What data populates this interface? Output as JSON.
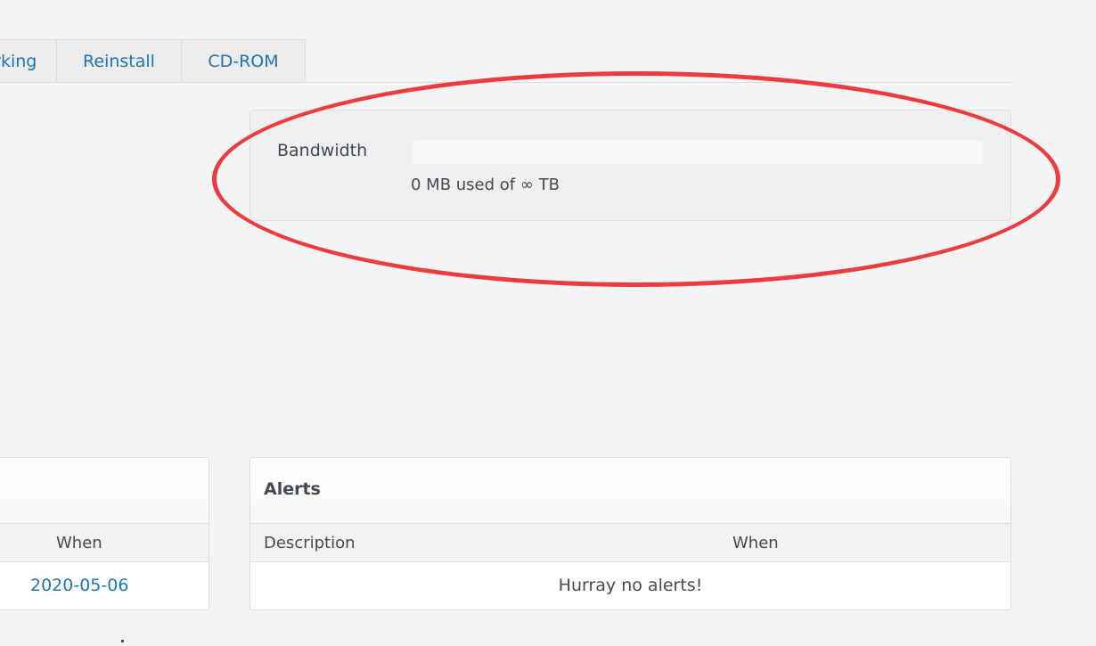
{
  "tabs": [
    {
      "label": "Networking"
    },
    {
      "label": "Reinstall"
    },
    {
      "label": "CD-ROM"
    }
  ],
  "bandwidth": {
    "label": "Bandwidth",
    "usage_text": "0 MB used of ∞ TB",
    "used_fraction": 0
  },
  "left_panel": {
    "column_header_when": "When",
    "rows": [
      {
        "when": "2020-05-06"
      }
    ]
  },
  "alerts_panel": {
    "title": "Alerts",
    "columns": [
      "Description",
      "When"
    ],
    "empty_message": "Hurray no alerts!"
  },
  "colors": {
    "link": "#1f73b7",
    "annotation_circle": "#ee3b3f",
    "text": "#3f4a55"
  }
}
